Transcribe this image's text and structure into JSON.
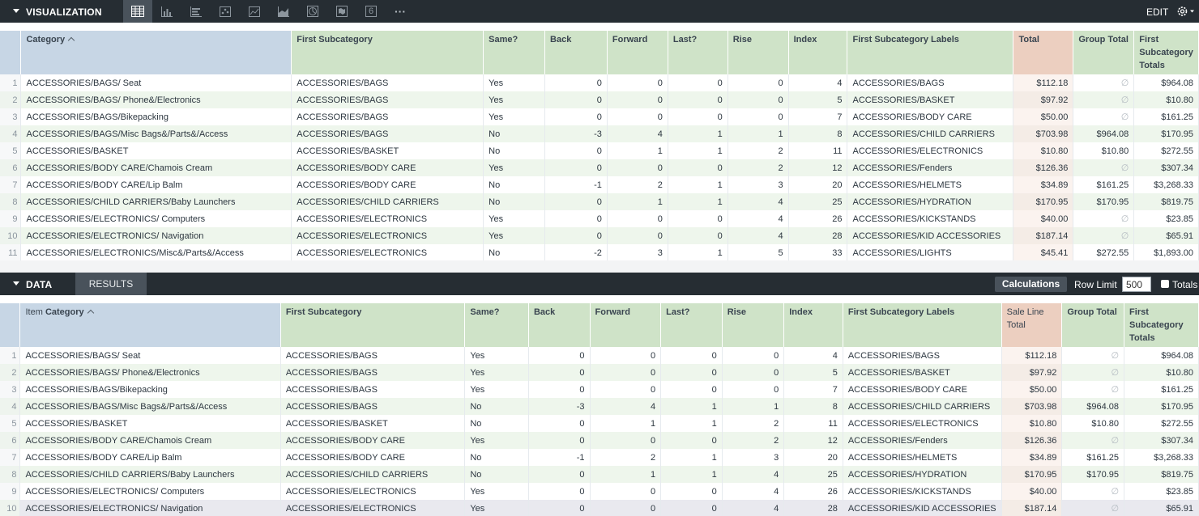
{
  "visualization_bar": {
    "title": "VISUALIZATION",
    "icons": [
      "table-icon",
      "bar-chart-icon",
      "horizontal-bar-icon",
      "scatter-icon",
      "line-chart-icon",
      "area-chart-icon",
      "pie-chart-icon",
      "map-icon",
      "single-value-icon",
      "more-icon"
    ],
    "single_value_glyph": "6",
    "more_glyph": "···",
    "edit_label": "EDIT"
  },
  "data_bar": {
    "title": "DATA",
    "results_tab": "RESULTS",
    "calculations_label": "Calculations",
    "row_limit_label": "Row Limit",
    "row_limit_value": "500",
    "totals_label": "Totals"
  },
  "viz_table": {
    "headers": {
      "category": "Category",
      "first_subcategory": "First Subcategory",
      "same": "Same?",
      "back": "Back",
      "forward": "Forward",
      "last": "Last?",
      "rise": "Rise",
      "index": "Index",
      "labels": "First Subcategory Labels",
      "total": "Total",
      "group_total": "Group Total",
      "sub_totals": "First Subcategory Totals"
    }
  },
  "data_table": {
    "headers": {
      "category_prefix": "Item",
      "category": "Category",
      "first_subcategory": "First Subcategory",
      "same": "Same?",
      "back": "Back",
      "forward": "Forward",
      "last": "Last?",
      "rise": "Rise",
      "index": "Index",
      "labels": "First Subcategory Labels",
      "total": "Sale Line Total",
      "group_total": "Group Total",
      "sub_totals": "First Subcategory Totals"
    }
  },
  "rows": [
    {
      "n": "1",
      "cat": "ACCESSORIES/BAGS/ Seat",
      "sub": "ACCESSORIES/BAGS",
      "same": "Yes",
      "back": "0",
      "fwd": "0",
      "last": "0",
      "rise": "0",
      "idx": "4",
      "label": "ACCESSORIES/BAGS",
      "total": "$112.18",
      "group": "∅",
      "subtot": "$964.08"
    },
    {
      "n": "2",
      "cat": "ACCESSORIES/BAGS/ Phone&/Electronics",
      "sub": "ACCESSORIES/BAGS",
      "same": "Yes",
      "back": "0",
      "fwd": "0",
      "last": "0",
      "rise": "0",
      "idx": "5",
      "label": "ACCESSORIES/BASKET",
      "total": "$97.92",
      "group": "∅",
      "subtot": "$10.80"
    },
    {
      "n": "3",
      "cat": "ACCESSORIES/BAGS/Bikepacking",
      "sub": "ACCESSORIES/BAGS",
      "same": "Yes",
      "back": "0",
      "fwd": "0",
      "last": "0",
      "rise": "0",
      "idx": "7",
      "label": "ACCESSORIES/BODY CARE",
      "total": "$50.00",
      "group": "∅",
      "subtot": "$161.25"
    },
    {
      "n": "4",
      "cat": "ACCESSORIES/BAGS/Misc Bags&/Parts&/Access",
      "sub": "ACCESSORIES/BAGS",
      "same": "No",
      "back": "-3",
      "fwd": "4",
      "last": "1",
      "rise": "1",
      "idx": "8",
      "label": "ACCESSORIES/CHILD CARRIERS",
      "total": "$703.98",
      "group": "$964.08",
      "subtot": "$170.95"
    },
    {
      "n": "5",
      "cat": "ACCESSORIES/BASKET",
      "sub": "ACCESSORIES/BASKET",
      "same": "No",
      "back": "0",
      "fwd": "1",
      "last": "1",
      "rise": "2",
      "idx": "11",
      "label": "ACCESSORIES/ELECTRONICS",
      "total": "$10.80",
      "group": "$10.80",
      "subtot": "$272.55"
    },
    {
      "n": "6",
      "cat": "ACCESSORIES/BODY CARE/Chamois Cream",
      "sub": "ACCESSORIES/BODY CARE",
      "same": "Yes",
      "back": "0",
      "fwd": "0",
      "last": "0",
      "rise": "2",
      "idx": "12",
      "label": "ACCESSORIES/Fenders",
      "total": "$126.36",
      "group": "∅",
      "subtot": "$307.34"
    },
    {
      "n": "7",
      "cat": "ACCESSORIES/BODY CARE/Lip Balm",
      "sub": "ACCESSORIES/BODY CARE",
      "same": "No",
      "back": "-1",
      "fwd": "2",
      "last": "1",
      "rise": "3",
      "idx": "20",
      "label": "ACCESSORIES/HELMETS",
      "total": "$34.89",
      "group": "$161.25",
      "subtot": "$3,268.33"
    },
    {
      "n": "8",
      "cat": "ACCESSORIES/CHILD CARRIERS/Baby Launchers",
      "sub": "ACCESSORIES/CHILD CARRIERS",
      "same": "No",
      "back": "0",
      "fwd": "1",
      "last": "1",
      "rise": "4",
      "idx": "25",
      "label": "ACCESSORIES/HYDRATION",
      "total": "$170.95",
      "group": "$170.95",
      "subtot": "$819.75"
    },
    {
      "n": "9",
      "cat": "ACCESSORIES/ELECTRONICS/ Computers",
      "sub": "ACCESSORIES/ELECTRONICS",
      "same": "Yes",
      "back": "0",
      "fwd": "0",
      "last": "0",
      "rise": "4",
      "idx": "26",
      "label": "ACCESSORIES/KICKSTANDS",
      "total": "$40.00",
      "group": "∅",
      "subtot": "$23.85"
    },
    {
      "n": "10",
      "cat": "ACCESSORIES/ELECTRONICS/ Navigation",
      "sub": "ACCESSORIES/ELECTRONICS",
      "same": "Yes",
      "back": "0",
      "fwd": "0",
      "last": "0",
      "rise": "4",
      "idx": "28",
      "label": "ACCESSORIES/KID ACCESSORIES",
      "total": "$187.14",
      "group": "∅",
      "subtot": "$65.91"
    },
    {
      "n": "11",
      "cat": "ACCESSORIES/ELECTRONICS/Misc&/Parts&/Access",
      "sub": "ACCESSORIES/ELECTRONICS",
      "same": "No",
      "back": "-2",
      "fwd": "3",
      "last": "1",
      "rise": "5",
      "idx": "33",
      "label": "ACCESSORIES/LIGHTS",
      "total": "$45.41",
      "group": "$272.55",
      "subtot": "$1,893.00"
    }
  ]
}
